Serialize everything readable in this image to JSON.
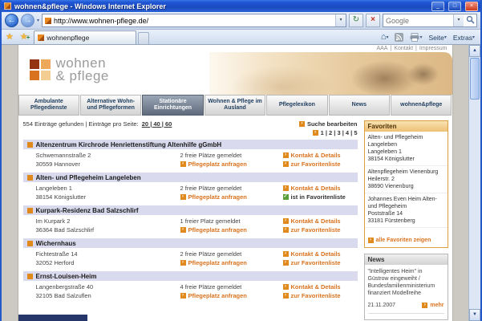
{
  "browser": {
    "title": "wohnen&pflege - Windows Internet Explorer",
    "url": "http://www.wohnen-pflege.de/",
    "search_placeholder": "Google",
    "tab_label": "wohnenpflege",
    "page_menu_label": "Seite",
    "tools_menu_label": "Extras"
  },
  "icons": {
    "minimize": "_",
    "maximize": "□",
    "close": "×",
    "back": "←",
    "forward": "→",
    "refresh": "↻",
    "stop": "×",
    "dropdown": "▾",
    "favorites_star": "★",
    "add_favorite_star": "★",
    "add_favorite_plus": "+",
    "home": "⌂",
    "link_arrow": "›",
    "check": "✓",
    "scroll_up": "▲",
    "scroll_down": "▼"
  },
  "site_header": {
    "logo_line1": "wohnen",
    "logo_line2": "& pflege",
    "font_sizer": "AAA",
    "sep": "|",
    "link_kontakt": "Kontakt",
    "link_impressum": "Impressum"
  },
  "nav_tabs": [
    "Ambulante Pflegedienste",
    "Alternative Wohn- und Pflegeformen",
    "Stationäre Einrichtungen",
    "Wohnen & Pflege im Ausland",
    "Pflegelexikon",
    "News",
    "wohnen&pflege"
  ],
  "nav_active_index": 2,
  "results": {
    "count_text": "554 Einträge gefunden",
    "sep": "|",
    "per_page_label": "Einträge pro Seite:",
    "per_page_links": "20 | 40 | 60",
    "edit_search": "Suche bearbeiten",
    "pagination": "1 | 2 | 3 | 4 | 5",
    "entries": [
      {
        "name": "Altenzentrum Kirchrode Henriettenstiftung Altenhilfe gGmbH",
        "street": "Schwemannstraße 2",
        "city": "30559 Hannover",
        "availability": "2 freie Plätze gemeldet",
        "contact": "Kontakt & Details",
        "request": "Pflegeplatz anfragen",
        "favorite": "zur Favoritenliste",
        "in_favorites": false
      },
      {
        "name": "Alten- und Pflegeheim Langeleben",
        "street": "Langeleben 1",
        "city": "38154 Königslutter",
        "availability": "2 freie Plätze gemeldet",
        "contact": "Kontakt & Details",
        "request": "Pflegeplatz anfragen",
        "favorite": "ist in Favoritenliste",
        "in_favorites": true
      },
      {
        "name": "Kurpark-Residenz Bad Salzschlirf",
        "street": "Im Kurpark 2",
        "city": "36364 Bad Salzschlirf",
        "availability": "1 freier Platz gemeldet",
        "contact": "Kontakt & Details",
        "request": "Pflegeplatz anfragen",
        "favorite": "zur Favoritenliste",
        "in_favorites": false
      },
      {
        "name": "Wichernhaus",
        "street": "Fichtestraße 14",
        "city": "32052 Herford",
        "availability": "2 freie Plätze gemeldet",
        "contact": "Kontakt & Details",
        "request": "Pflegeplatz anfragen",
        "favorite": "zur Favoritenliste",
        "in_favorites": false
      },
      {
        "name": "Ernst-Louisen-Heim",
        "street": "Langenbergstraße 40",
        "city": "32105 Bad Salzuflen",
        "availability": "4 freie Plätze gemeldet",
        "contact": "Kontakt & Details",
        "request": "Pflegeplatz anfragen",
        "favorite": "zur Favoritenliste",
        "in_favorites": false
      }
    ]
  },
  "sidebar": {
    "favorites": {
      "title": "Favoriten",
      "items": [
        {
          "name": "Alten- und Pflegeheim Langeleben",
          "street": "Langeleben 1",
          "city": "38154 Königslutter"
        },
        {
          "name": "Altenpflegeheim Vienenburg",
          "street": "Heilerstr. 2",
          "city": "38690 Vienenburg"
        },
        {
          "name": "Johannes Even Heim Alten- und Pflegeheim",
          "street": "Poststraße 14",
          "city": "33181 Fürstenberg"
        }
      ],
      "show_all": "alle Favoriten zeigen"
    },
    "news": {
      "title": "News",
      "headline": "\"Intelligentes Heim\" in Güstrow eingeweiht / Bundesfamilienministerium finanziert Modellreihe",
      "date": "21.11.2007",
      "more": "mehr"
    }
  },
  "colors": {
    "accent_orange": "#d9731f",
    "row_lavender": "#d9daed",
    "favorites_border": "#dd9f3e",
    "active_tab": "#5f6b7c",
    "titlebar_blue": "#1f55d2"
  }
}
